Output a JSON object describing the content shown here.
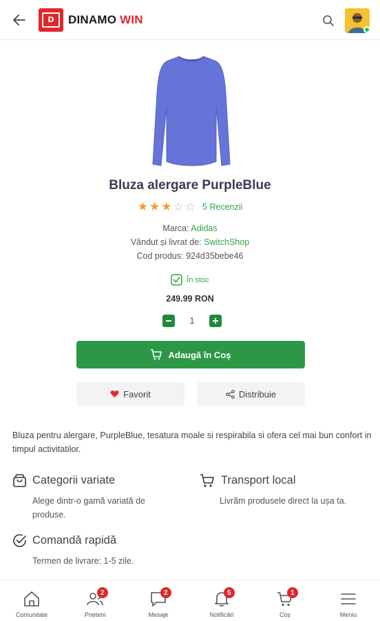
{
  "header": {
    "logo_mark": "D",
    "brand_part1": "DINAMO",
    "brand_part2": "WIN"
  },
  "product": {
    "title": "Bluza alergare PurpleBlue",
    "rating": 3,
    "rating_max": 5,
    "reviews_label": "5 Recenzii",
    "brand_label": "Marca:",
    "brand_value": "Adidas",
    "seller_label": "Vândut și livrat de:",
    "seller_value": "SwitchShop",
    "code_label": "Cod produs:",
    "code_value": "924d35bebe46",
    "stock_label": "În stoc",
    "price": "249.99 RON",
    "quantity": "1",
    "add_to_cart": "Adaugă în Coș",
    "favorite": "Favorit",
    "share": "Distribuie",
    "description": "Bluza pentru alergare, PurpleBlue, tesatura moale si respirabila si ofera cel mai bun confort in timpul activitatilor."
  },
  "features": [
    {
      "icon": "shopping-bag-icon",
      "title": "Categorii variate",
      "text": "Alege dintr-o gamă variată de produse."
    },
    {
      "icon": "cart-icon",
      "title": "Transport local",
      "text": "Livrăm produsele direct la ușa ta."
    },
    {
      "icon": "check-circle-icon",
      "title": "Comandă rapidă",
      "text": "Termen de livrare: 1-5 zile."
    }
  ],
  "nav": [
    {
      "label": "Comunitate",
      "badge": ""
    },
    {
      "label": "Prieteni",
      "badge": "2"
    },
    {
      "label": "Mesaje",
      "badge": "2"
    },
    {
      "label": "Notificări",
      "badge": "5"
    },
    {
      "label": "Coș",
      "badge": "1"
    },
    {
      "label": "Meniu",
      "badge": ""
    }
  ],
  "colors": {
    "accent": "#2c9846",
    "brand_red": "#e3262b",
    "star": "#f29a2e",
    "product": "#6673d8"
  }
}
